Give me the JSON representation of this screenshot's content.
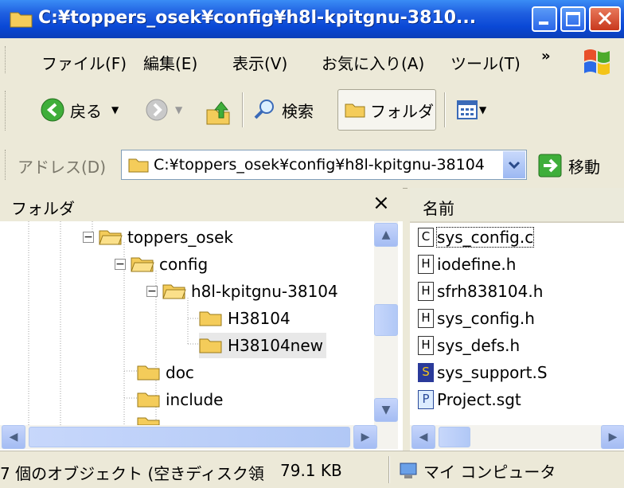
{
  "window": {
    "title": "C:¥toppers_osek¥config¥h8l-kpitgnu-3810..."
  },
  "menu": [
    "ファイル(F)",
    "編集(E)",
    "表示(V)",
    "お気に入り(A)",
    "ツール(T)"
  ],
  "menu_overflow": "»",
  "toolbar": {
    "back": "戻る",
    "search": "検索",
    "folders": "フォルダ"
  },
  "address": {
    "label": "アドレス(D)",
    "value": "C:¥toppers_osek¥config¥h8l-kpitgnu-38104",
    "go": "移動"
  },
  "folder_pane": {
    "title": "フォルダ",
    "close": "×",
    "tree": [
      {
        "label": "toppers_osek",
        "expander": "−"
      },
      {
        "label": "config",
        "expander": "−"
      },
      {
        "label": "h8l-kpitgnu-38104",
        "expander": "−"
      },
      {
        "label": "H38104"
      },
      {
        "label": "H38104new",
        "selected": true
      },
      {
        "label": "doc"
      },
      {
        "label": "include"
      }
    ]
  },
  "file_pane": {
    "column_name": "名前",
    "files": [
      {
        "name": "sys_config.c",
        "icon": "C"
      },
      {
        "name": "iodefine.h",
        "icon": "H"
      },
      {
        "name": "sfrh838104.h",
        "icon": "H"
      },
      {
        "name": "sys_config.h",
        "icon": "H"
      },
      {
        "name": "sys_defs.h",
        "icon": "H"
      },
      {
        "name": "sys_support.S",
        "icon": "S"
      },
      {
        "name": "Project.sgt",
        "icon": "P"
      }
    ]
  },
  "status": {
    "objects": "7 個のオブジェクト (空きディスク領",
    "size": "79.1 KB",
    "location": "マイ コンピュータ"
  }
}
